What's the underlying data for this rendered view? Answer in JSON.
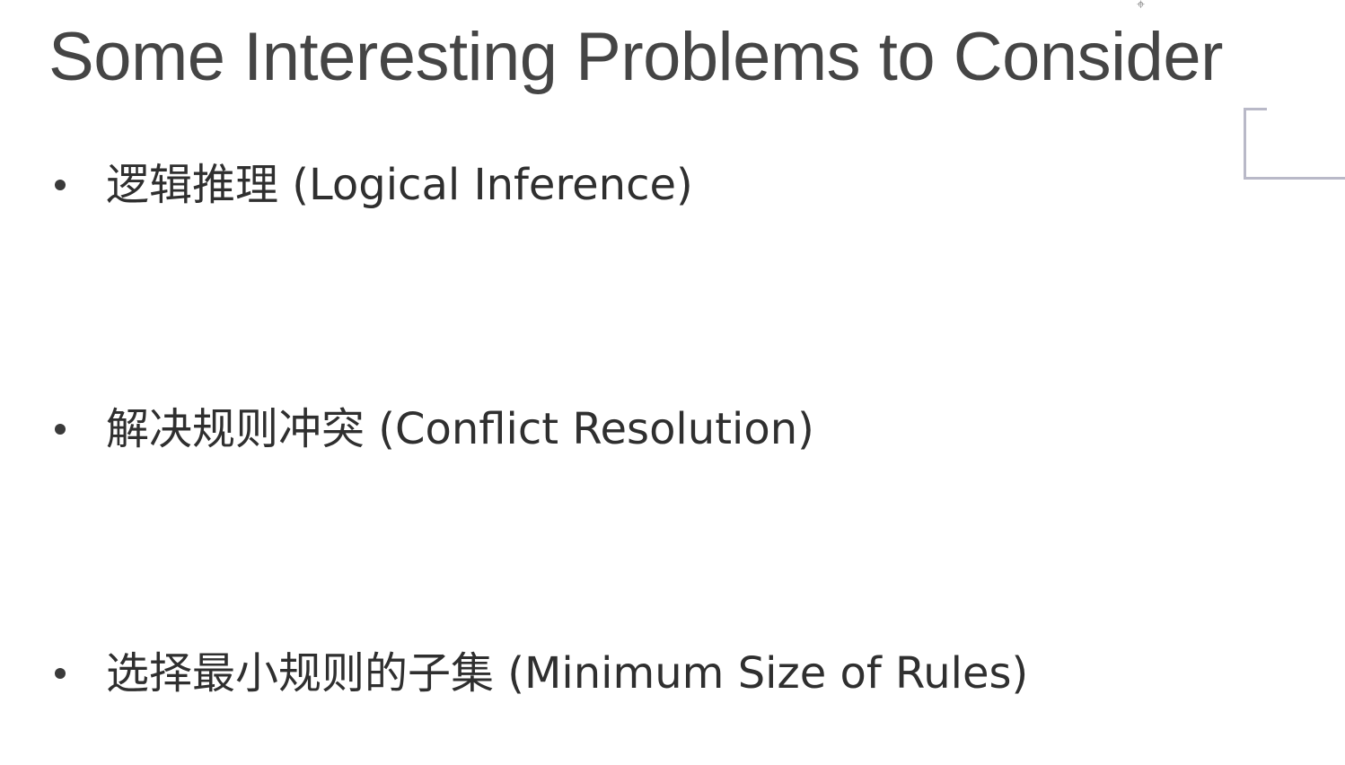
{
  "slide": {
    "title": "Some Interesting Problems to Consider",
    "bullets": [
      {
        "text": "逻辑推理 (Logical Inference)"
      },
      {
        "text": "解决规则冲突 (Conflict Resolution)"
      },
      {
        "text": "选择最小规则的子集 (Minimum Size of Rules)"
      }
    ]
  },
  "icons": {
    "cursor": "crosshair-cursor-icon",
    "frame": "selection-frame-corner"
  },
  "colors": {
    "background": "#ffffff",
    "title": "#454545",
    "text": "#2f2f2f",
    "frame": "#b9b9c8"
  }
}
